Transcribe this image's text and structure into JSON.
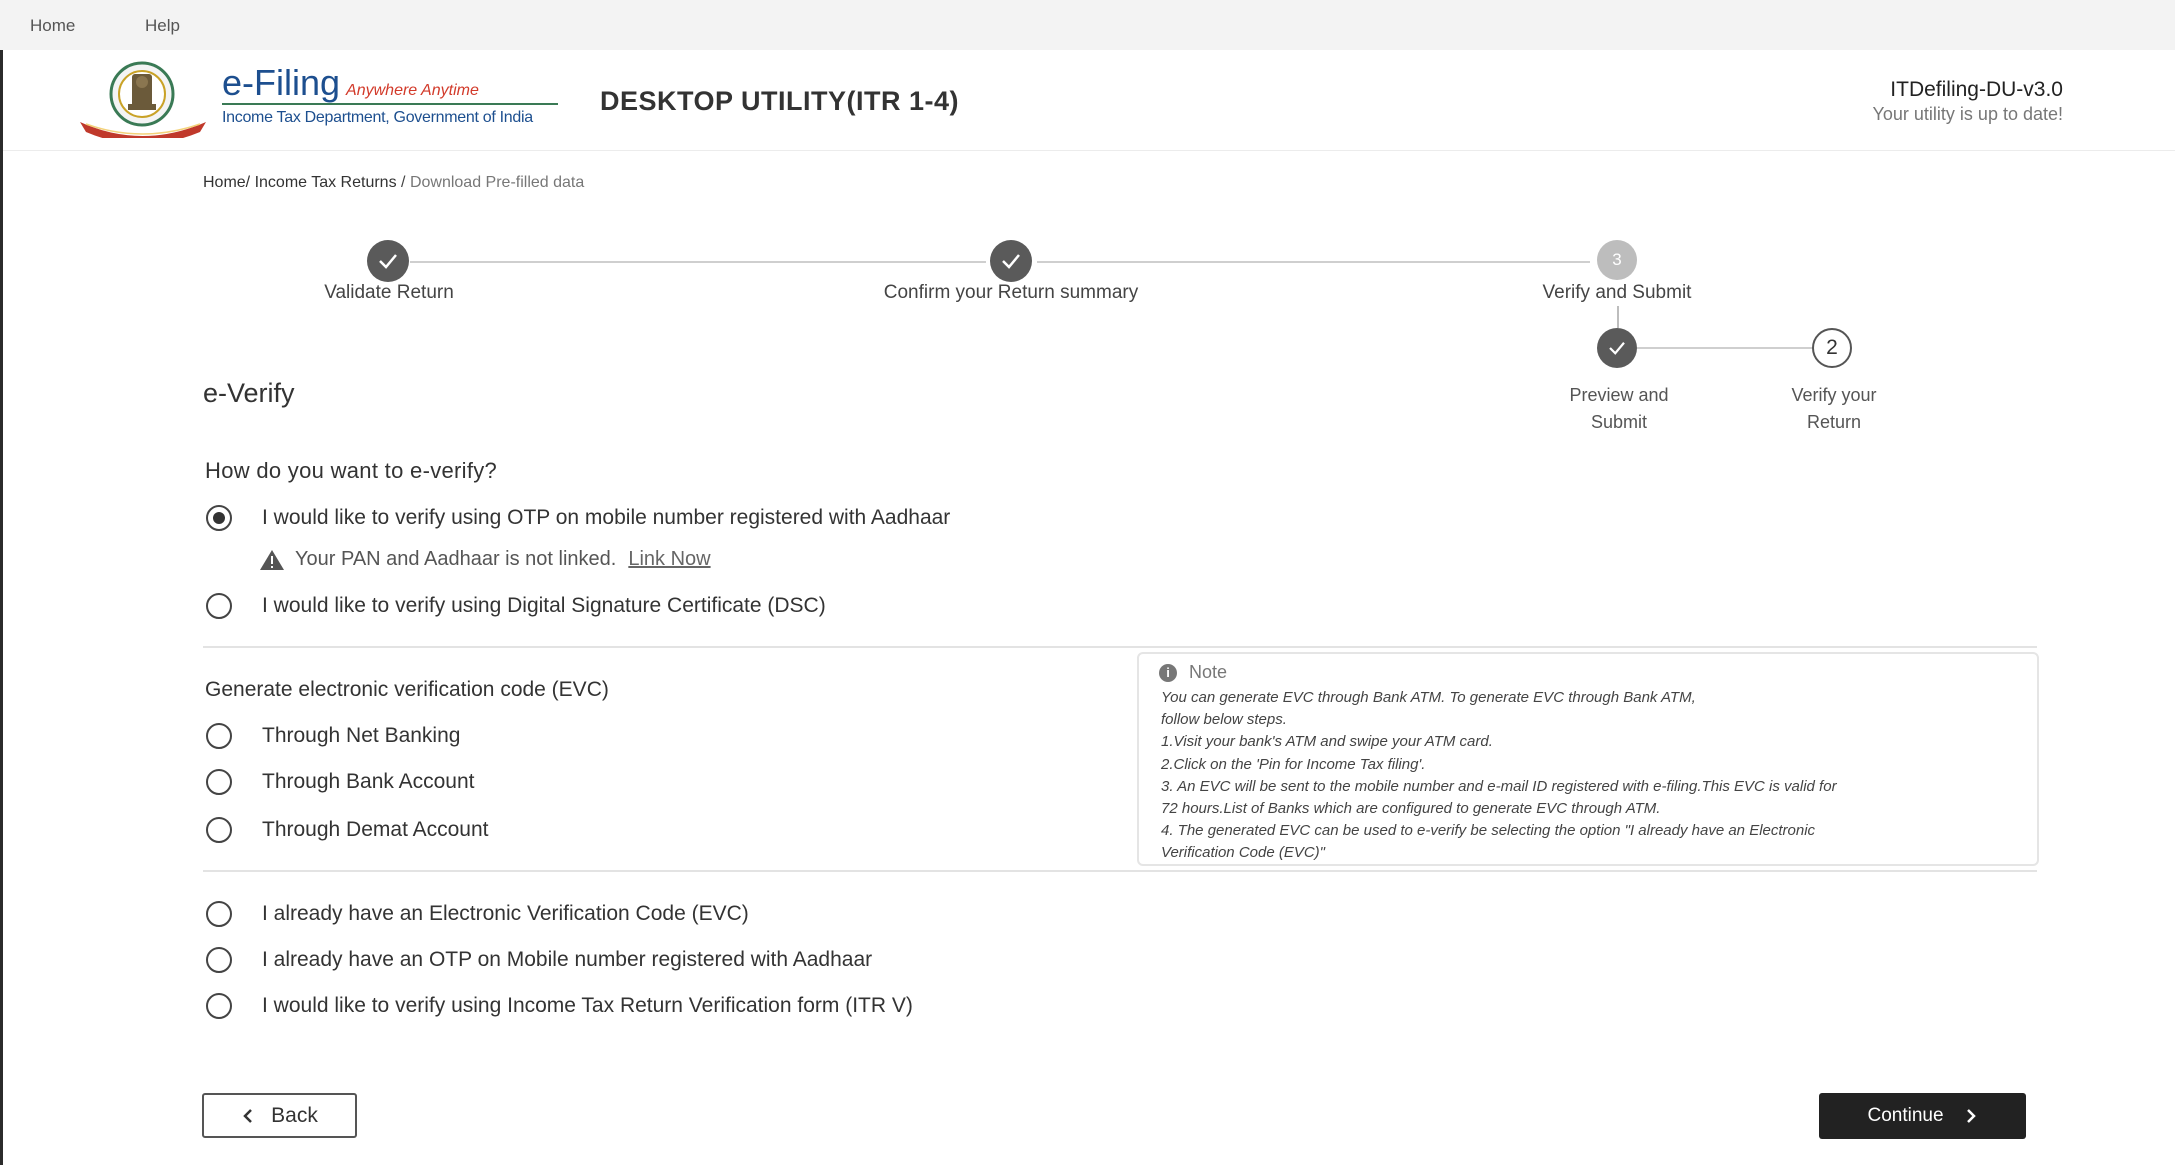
{
  "menubar": {
    "home": "Home",
    "help": "Help"
  },
  "header": {
    "brand_title": "e-Filing",
    "brand_tagline": "Anywhere Anytime",
    "brand_subtitle": "Income Tax Department, Government of India",
    "app_title": "DESKTOP UTILITY(ITR 1-4)",
    "version": "ITDefiling-DU-v3.0",
    "version_status": "Your utility is up to date!"
  },
  "breadcrumb": {
    "home": "Home/",
    "itr": "Income Tax Returns",
    "sep": "/",
    "current": "Download Pre-filled data"
  },
  "stepper": {
    "steps": [
      {
        "label": "Validate Return",
        "status": "done"
      },
      {
        "label": "Confirm your Return summary",
        "status": "done"
      },
      {
        "label": "Verify and Submit",
        "number": "3",
        "status": "current"
      }
    ],
    "substeps": [
      {
        "label": "Preview and Submit",
        "status": "done"
      },
      {
        "label": "Verify your Return",
        "number": "2",
        "status": "current"
      }
    ]
  },
  "section_title": "e-Verify",
  "question": "How do you want to e-verify?",
  "options": {
    "otp_aadhaar": "I would like to verify using OTP on mobile number registered with Aadhaar",
    "dsc": "I would like to verify using Digital Signature Certificate (DSC)",
    "net_banking": "Through Net Banking",
    "bank_account": "Through Bank Account",
    "demat_account": "Through Demat Account",
    "have_evc": "I already have an Electronic Verification Code (EVC)",
    "have_otp": "I already have an OTP on Mobile number registered with Aadhaar",
    "itr_v": "I would like to verify using Income Tax Return Verification form (ITR V)"
  },
  "selected_option": "otp_aadhaar",
  "warning": {
    "text": "Your PAN and Aadhaar is not linked.",
    "link": "Link Now"
  },
  "evc_title": "Generate electronic verification code (EVC)",
  "note": {
    "title": "Note",
    "lines": [
      "You can generate EVC through Bank ATM. To generate EVC through Bank ATM,",
      "follow below steps.",
      "1.Visit your bank's ATM and swipe your ATM card.",
      "2.Click on the 'Pin for Income Tax filing'.",
      "3. An EVC will be sent to the mobile number and e-mail ID registered with e-filing.This EVC is valid for",
      "72 hours.List of Banks which are configured to generate EVC through ATM.",
      "4. The generated EVC can be used to e-verify be selecting the option \"I already have an Electronic",
      "Verification Code (EVC)\""
    ]
  },
  "buttons": {
    "back": "Back",
    "continue": "Continue"
  },
  "colors": {
    "brand_blue": "#1d4f8f",
    "tagline_red": "#d23a2a",
    "primary_button": "#222222",
    "done_step": "#5a5a5a",
    "pending_step": "#bdbdbd"
  }
}
